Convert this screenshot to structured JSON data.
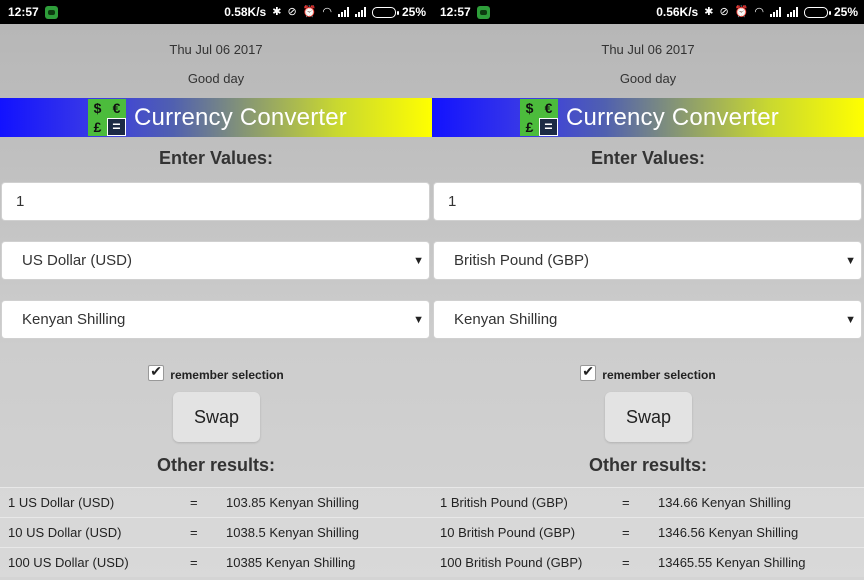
{
  "screens": [
    {
      "status": {
        "time": "12:57",
        "speed": "0.58K/s",
        "battery": "25%"
      },
      "date": "Thu Jul 06 2017",
      "greeting": "Good day",
      "banner_title": "Currency Converter",
      "enter_label": "Enter Values:",
      "amount": "1",
      "from_currency": "US Dollar (USD)",
      "to_currency": "Kenyan Shilling",
      "remember_label": "remember selection",
      "swap_label": "Swap",
      "other_label": "Other results:",
      "results": [
        {
          "from": "1 US Dollar (USD)",
          "eq": "=",
          "to": "103.85 Kenyan Shilling"
        },
        {
          "from": "10 US Dollar (USD)",
          "eq": "=",
          "to": "1038.5 Kenyan Shilling"
        },
        {
          "from": "100 US Dollar (USD)",
          "eq": "=",
          "to": "10385 Kenyan Shilling"
        }
      ]
    },
    {
      "status": {
        "time": "12:57",
        "speed": "0.56K/s",
        "battery": "25%"
      },
      "date": "Thu Jul 06 2017",
      "greeting": "Good day",
      "banner_title": "Currency Converter",
      "enter_label": "Enter Values:",
      "amount": "1",
      "from_currency": "British Pound (GBP)",
      "to_currency": "Kenyan Shilling",
      "remember_label": "remember selection",
      "swap_label": "Swap",
      "other_label": "Other results:",
      "results": [
        {
          "from": "1 British Pound (GBP)",
          "eq": "=",
          "to": "134.66 Kenyan Shilling"
        },
        {
          "from": "10 British Pound (GBP)",
          "eq": "=",
          "to": "1346.56 Kenyan Shilling"
        },
        {
          "from": "100 British Pound (GBP)",
          "eq": "=",
          "to": "13465.55 Kenyan Shilling"
        }
      ]
    }
  ],
  "logo_glyphs": [
    "$",
    "€",
    "£",
    "="
  ],
  "icons": {
    "bluetooth": "bluetooth-icon",
    "mute": "mute-icon",
    "alarm": "alarm-icon",
    "wifi": "wifi-icon",
    "signal": "signal-icon",
    "battery": "battery-icon",
    "dropdown": "dropdown-arrow-icon",
    "check": "checkmark-icon"
  },
  "colors": {
    "banner_start": "#1212ff",
    "banner_end": "#ffff00",
    "logo_green": "#4cbc3c"
  }
}
